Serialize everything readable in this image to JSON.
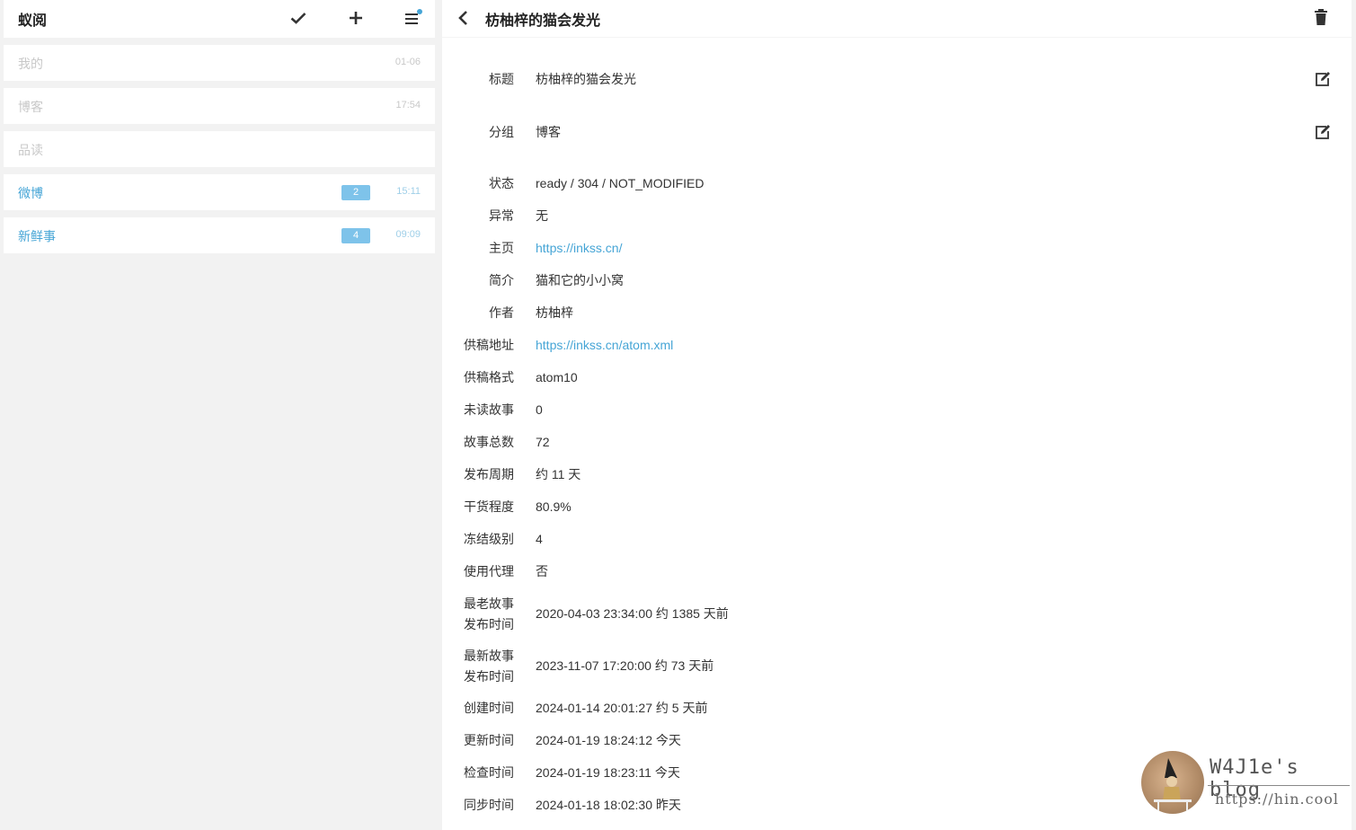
{
  "app": {
    "title": "蚁阅"
  },
  "sidebar": {
    "groups": [
      {
        "name": "我的",
        "time": "01-06",
        "badge": "",
        "active": false
      },
      {
        "name": "博客",
        "time": "17:54",
        "badge": "",
        "active": false
      },
      {
        "name": "品读",
        "time": "",
        "badge": "",
        "active": false
      },
      {
        "name": "微博",
        "time": "15:11",
        "badge": "2",
        "active": true
      },
      {
        "name": "新鲜事",
        "time": "09:09",
        "badge": "4",
        "active": true
      }
    ]
  },
  "detail": {
    "title": "枋柚梓的猫会发光",
    "fields": {
      "title_label": "标题",
      "title_value": "枋柚梓的猫会发光",
      "group_label": "分组",
      "group_value": "博客",
      "status_label": "状态",
      "status_value": "ready / 304 / NOT_MODIFIED",
      "error_label": "异常",
      "error_value": "无",
      "home_label": "主页",
      "home_value": "https://inkss.cn/",
      "desc_label": "简介",
      "desc_value": "猫和它的小小窝",
      "author_label": "作者",
      "author_value": "枋柚梓",
      "feed_url_label": "供稿地址",
      "feed_url_value": "https://inkss.cn/atom.xml",
      "feed_format_label": "供稿格式",
      "feed_format_value": "atom10",
      "unread_label": "未读故事",
      "unread_value": "0",
      "total_label": "故事总数",
      "total_value": "72",
      "period_label": "发布周期",
      "period_value": "约 11 天",
      "dryness_label": "干货程度",
      "dryness_value": "80.9%",
      "freeze_label": "冻结级别",
      "freeze_value": "4",
      "proxy_label": "使用代理",
      "proxy_value": "否",
      "oldest_label_1": "最老故事",
      "oldest_label_2": "发布时间",
      "oldest_value": "2020-04-03 23:34:00 约 1385 天前",
      "newest_label_1": "最新故事",
      "newest_label_2": "发布时间",
      "newest_value": "2023-11-07 17:20:00 约 73 天前",
      "created_label": "创建时间",
      "created_value": "2024-01-14 20:01:27 约 5 天前",
      "updated_label": "更新时间",
      "updated_value": "2024-01-19 18:24:12 今天",
      "checked_label": "检查时间",
      "checked_value": "2024-01-19 18:23:11 今天",
      "synced_label": "同步时间",
      "synced_value": "2024-01-18 18:02:30 昨天"
    }
  },
  "watermark": {
    "blog": "W4J1e's blog",
    "url": "https://hin.cool"
  },
  "colors": {
    "accent": "#46a5d6",
    "badge": "#7ec3ea",
    "muted": "#c8c8c8"
  },
  "icons": [
    "check-icon",
    "plus-icon",
    "menu-icon",
    "back-icon",
    "trash-icon",
    "edit-icon"
  ]
}
